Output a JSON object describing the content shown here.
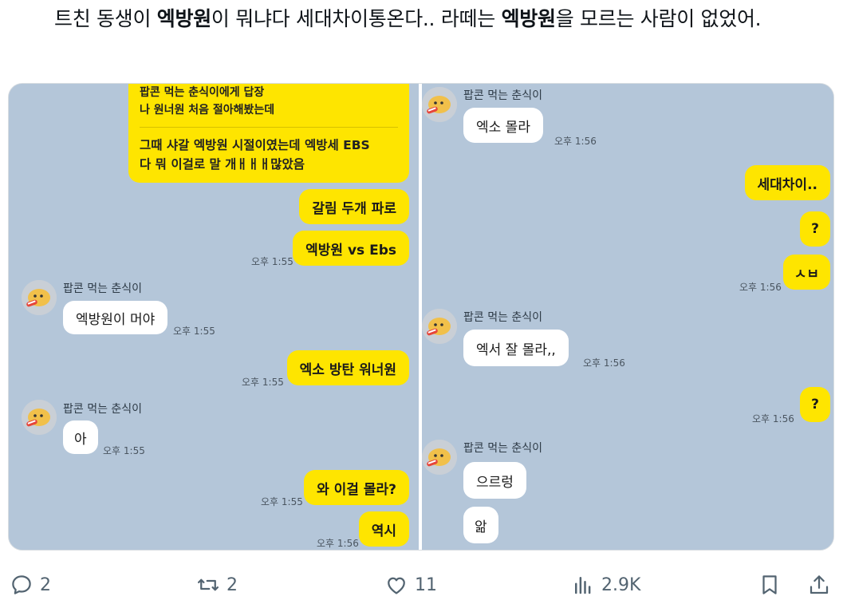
{
  "post": {
    "text_parts": [
      "트친 동생이 ",
      "엑방원",
      "이 뭐냐다 세대차이통온다.. 라떼는 ",
      "엑방원",
      "을 모르는 사람이 없었어."
    ]
  },
  "chat_left": {
    "top_bubble": {
      "line1": "팝콘 먹는 춘식이에게 답장",
      "line2": "나 원너원 처음 절아해봤는데",
      "line3": "그때 샤갈 엑방원 시절이였는데 엑방세 EBS",
      "line4": "다 뭐 이걸로 말 개ㅐㅐㅐ많았음"
    },
    "me1": "갈림 두개 파로",
    "me2": "엑방원 vs Ebs",
    "time1": "오후 1:55",
    "name1": "팝콘 먹는 춘식이",
    "them1": "엑방원이 머야",
    "time2": "오후 1:55",
    "me3": "엑소 방탄 워너원",
    "time3": "오후 1:55",
    "name2": "팝콘 먹는 춘식이",
    "them2": "아",
    "time4": "오후 1:55",
    "me4": "와 이걸 몰라?",
    "time5": "오후 1:55",
    "me5": "역시",
    "time6": "오후 1:56"
  },
  "chat_right": {
    "name1": "팝콘 먹는 춘식이",
    "them1": "엑소 몰라",
    "time1": "오후 1:56",
    "me1": "세대차이..",
    "me2": "?",
    "me3": "ㅅㅂ",
    "time2": "오후 1:56",
    "name2": "팝콘 먹는 춘식이",
    "them2": "엑서 잘 몰라,,",
    "time3": "오후 1:56",
    "me4": "?",
    "time4": "오후 1:56",
    "name3": "팝콘 먹는 춘식이",
    "them3": "으르렁",
    "them4": "앎"
  },
  "actions": {
    "reply_count": "2",
    "repost_count": "2",
    "like_count": "11",
    "views_count": "2.9K",
    "icons": [
      "reply-icon",
      "repost-icon",
      "like-icon",
      "views-icon",
      "bookmark-icon",
      "share-icon"
    ]
  },
  "colors": {
    "my_bubble": "#fee500",
    "chat_bg": "#b4c6d9",
    "icon": "#536471"
  }
}
